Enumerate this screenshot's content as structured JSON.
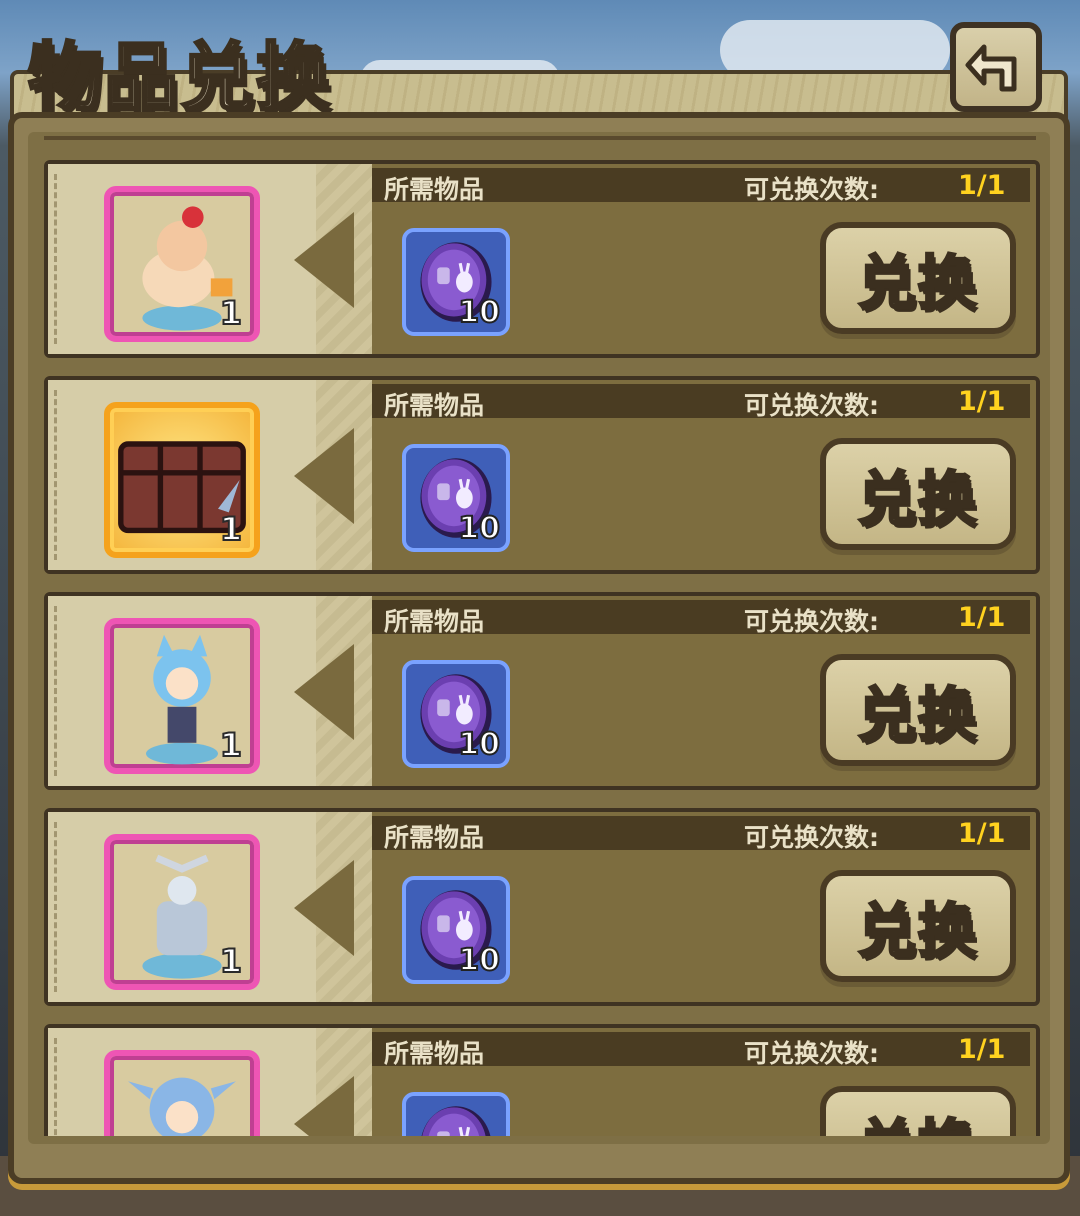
{
  "header": {
    "title": "物品兑换",
    "back_icon": "back-arrow-icon"
  },
  "labels": {
    "required_items": "所需物品",
    "exchange_count": "可兑换次数:",
    "redeem": "兑换"
  },
  "colors": {
    "count_value": "#ffd21f",
    "epic_frame": "#ee55b4",
    "legendary_frame": "#f5a21c",
    "coin_frame": "#7aa2ff"
  },
  "rows": [
    {
      "reward_icon": "cake-girl-figurine-icon",
      "reward_frame": "pink",
      "reward_qty": "1",
      "cost_icon": "purple-rabbit-coin-icon",
      "cost_qty": "10",
      "count": "1/1"
    },
    {
      "reward_icon": "wooden-crate-icon",
      "reward_frame": "gold",
      "reward_qty": "1",
      "cost_icon": "purple-rabbit-coin-icon",
      "cost_qty": "10",
      "count": "1/1"
    },
    {
      "reward_icon": "blue-cat-girl-figurine-icon",
      "reward_frame": "pink",
      "reward_qty": "1",
      "cost_icon": "purple-rabbit-coin-icon",
      "cost_qty": "10",
      "count": "1/1"
    },
    {
      "reward_icon": "mech-figurine-icon",
      "reward_frame": "pink",
      "reward_qty": "1",
      "cost_icon": "purple-rabbit-coin-icon",
      "cost_qty": "10",
      "count": "1/1"
    },
    {
      "reward_icon": "blue-hair-warrior-figurine-icon",
      "reward_frame": "pink",
      "reward_qty": "",
      "cost_icon": "purple-rabbit-coin-icon",
      "cost_qty": "",
      "count": "1/1"
    }
  ]
}
